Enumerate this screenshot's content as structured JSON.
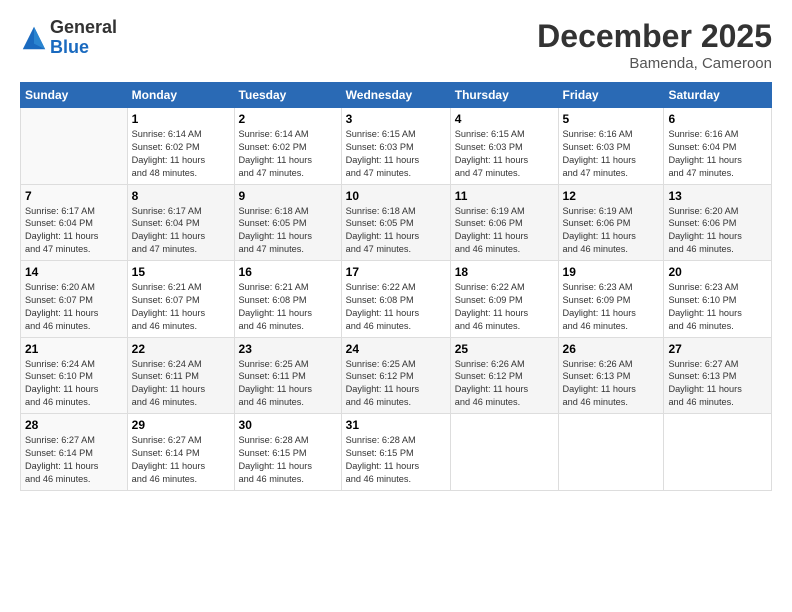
{
  "logo": {
    "general": "General",
    "blue": "Blue"
  },
  "title": "December 2025",
  "location": "Bamenda, Cameroon",
  "days_of_week": [
    "Sunday",
    "Monday",
    "Tuesday",
    "Wednesday",
    "Thursday",
    "Friday",
    "Saturday"
  ],
  "weeks": [
    [
      {
        "day": "",
        "info": ""
      },
      {
        "day": "1",
        "info": "Sunrise: 6:14 AM\nSunset: 6:02 PM\nDaylight: 11 hours\nand 48 minutes."
      },
      {
        "day": "2",
        "info": "Sunrise: 6:14 AM\nSunset: 6:02 PM\nDaylight: 11 hours\nand 47 minutes."
      },
      {
        "day": "3",
        "info": "Sunrise: 6:15 AM\nSunset: 6:03 PM\nDaylight: 11 hours\nand 47 minutes."
      },
      {
        "day": "4",
        "info": "Sunrise: 6:15 AM\nSunset: 6:03 PM\nDaylight: 11 hours\nand 47 minutes."
      },
      {
        "day": "5",
        "info": "Sunrise: 6:16 AM\nSunset: 6:03 PM\nDaylight: 11 hours\nand 47 minutes."
      },
      {
        "day": "6",
        "info": "Sunrise: 6:16 AM\nSunset: 6:04 PM\nDaylight: 11 hours\nand 47 minutes."
      }
    ],
    [
      {
        "day": "7",
        "info": "Sunrise: 6:17 AM\nSunset: 6:04 PM\nDaylight: 11 hours\nand 47 minutes."
      },
      {
        "day": "8",
        "info": "Sunrise: 6:17 AM\nSunset: 6:04 PM\nDaylight: 11 hours\nand 47 minutes."
      },
      {
        "day": "9",
        "info": "Sunrise: 6:18 AM\nSunset: 6:05 PM\nDaylight: 11 hours\nand 47 minutes."
      },
      {
        "day": "10",
        "info": "Sunrise: 6:18 AM\nSunset: 6:05 PM\nDaylight: 11 hours\nand 47 minutes."
      },
      {
        "day": "11",
        "info": "Sunrise: 6:19 AM\nSunset: 6:06 PM\nDaylight: 11 hours\nand 46 minutes."
      },
      {
        "day": "12",
        "info": "Sunrise: 6:19 AM\nSunset: 6:06 PM\nDaylight: 11 hours\nand 46 minutes."
      },
      {
        "day": "13",
        "info": "Sunrise: 6:20 AM\nSunset: 6:06 PM\nDaylight: 11 hours\nand 46 minutes."
      }
    ],
    [
      {
        "day": "14",
        "info": "Sunrise: 6:20 AM\nSunset: 6:07 PM\nDaylight: 11 hours\nand 46 minutes."
      },
      {
        "day": "15",
        "info": "Sunrise: 6:21 AM\nSunset: 6:07 PM\nDaylight: 11 hours\nand 46 minutes."
      },
      {
        "day": "16",
        "info": "Sunrise: 6:21 AM\nSunset: 6:08 PM\nDaylight: 11 hours\nand 46 minutes."
      },
      {
        "day": "17",
        "info": "Sunrise: 6:22 AM\nSunset: 6:08 PM\nDaylight: 11 hours\nand 46 minutes."
      },
      {
        "day": "18",
        "info": "Sunrise: 6:22 AM\nSunset: 6:09 PM\nDaylight: 11 hours\nand 46 minutes."
      },
      {
        "day": "19",
        "info": "Sunrise: 6:23 AM\nSunset: 6:09 PM\nDaylight: 11 hours\nand 46 minutes."
      },
      {
        "day": "20",
        "info": "Sunrise: 6:23 AM\nSunset: 6:10 PM\nDaylight: 11 hours\nand 46 minutes."
      }
    ],
    [
      {
        "day": "21",
        "info": "Sunrise: 6:24 AM\nSunset: 6:10 PM\nDaylight: 11 hours\nand 46 minutes."
      },
      {
        "day": "22",
        "info": "Sunrise: 6:24 AM\nSunset: 6:11 PM\nDaylight: 11 hours\nand 46 minutes."
      },
      {
        "day": "23",
        "info": "Sunrise: 6:25 AM\nSunset: 6:11 PM\nDaylight: 11 hours\nand 46 minutes."
      },
      {
        "day": "24",
        "info": "Sunrise: 6:25 AM\nSunset: 6:12 PM\nDaylight: 11 hours\nand 46 minutes."
      },
      {
        "day": "25",
        "info": "Sunrise: 6:26 AM\nSunset: 6:12 PM\nDaylight: 11 hours\nand 46 minutes."
      },
      {
        "day": "26",
        "info": "Sunrise: 6:26 AM\nSunset: 6:13 PM\nDaylight: 11 hours\nand 46 minutes."
      },
      {
        "day": "27",
        "info": "Sunrise: 6:27 AM\nSunset: 6:13 PM\nDaylight: 11 hours\nand 46 minutes."
      }
    ],
    [
      {
        "day": "28",
        "info": "Sunrise: 6:27 AM\nSunset: 6:14 PM\nDaylight: 11 hours\nand 46 minutes."
      },
      {
        "day": "29",
        "info": "Sunrise: 6:27 AM\nSunset: 6:14 PM\nDaylight: 11 hours\nand 46 minutes."
      },
      {
        "day": "30",
        "info": "Sunrise: 6:28 AM\nSunset: 6:15 PM\nDaylight: 11 hours\nand 46 minutes."
      },
      {
        "day": "31",
        "info": "Sunrise: 6:28 AM\nSunset: 6:15 PM\nDaylight: 11 hours\nand 46 minutes."
      },
      {
        "day": "",
        "info": ""
      },
      {
        "day": "",
        "info": ""
      },
      {
        "day": "",
        "info": ""
      }
    ]
  ]
}
